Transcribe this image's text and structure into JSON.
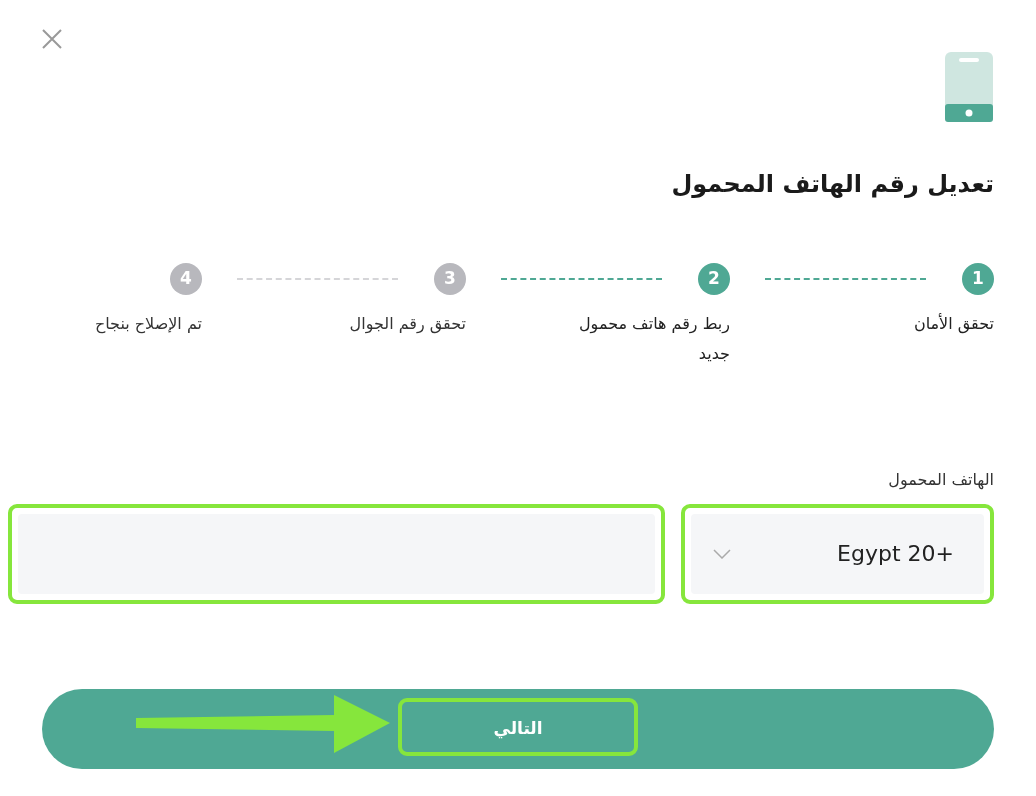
{
  "title": "تعديل رقم الهاتف المحمول",
  "steps": [
    {
      "number": "1",
      "label": "تحقق الأمان",
      "active": true
    },
    {
      "number": "2",
      "label": "ربط رقم هاتف محمول جديد",
      "active": true
    },
    {
      "number": "3",
      "label": "تحقق رقم الجوال",
      "active": false
    },
    {
      "number": "4",
      "label": "تم الإصلاح بنجاح",
      "active": false
    }
  ],
  "phone": {
    "label": "الهاتف المحمول",
    "country": "Egypt 20+",
    "country_highlighted": true,
    "number_highlighted": true
  },
  "button": {
    "label": "التالي",
    "highlighted": true,
    "arrow": true
  }
}
